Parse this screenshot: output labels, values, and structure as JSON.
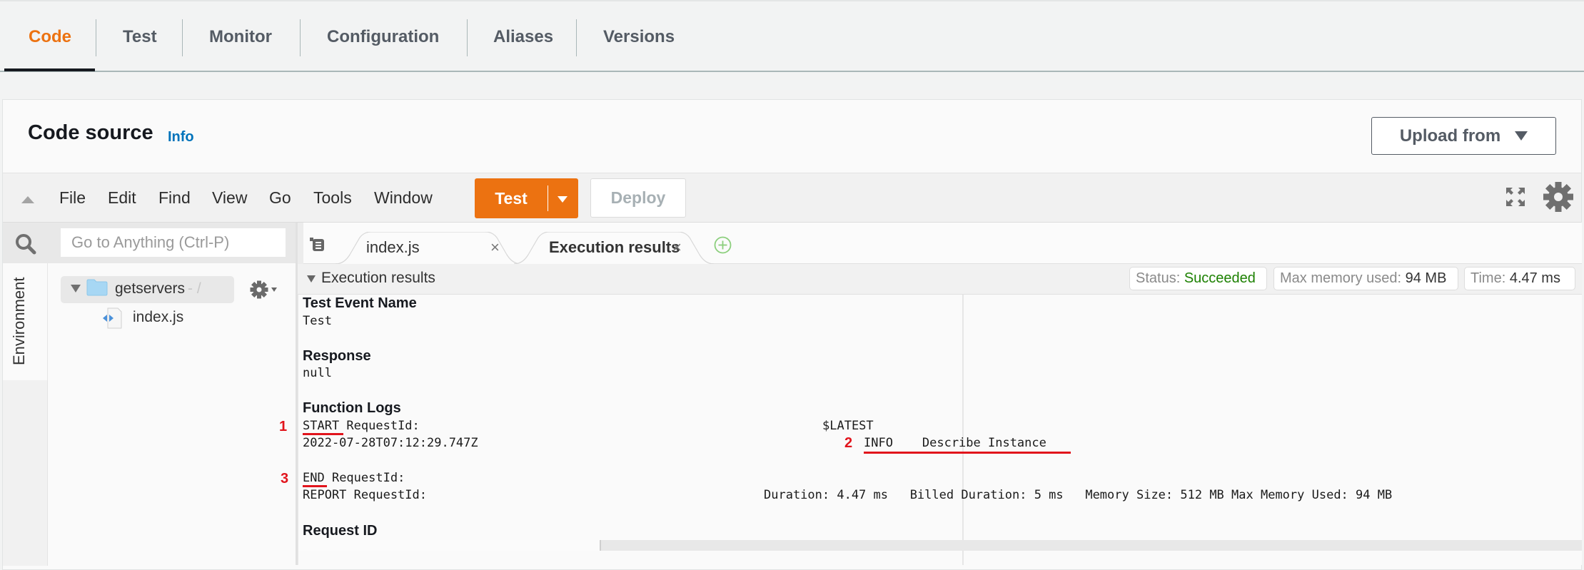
{
  "top_tabs": [
    {
      "label": "Code",
      "active": true
    },
    {
      "label": "Test",
      "active": false
    },
    {
      "label": "Monitor",
      "active": false
    },
    {
      "label": "Configuration",
      "active": false
    },
    {
      "label": "Aliases",
      "active": false
    },
    {
      "label": "Versions",
      "active": false
    }
  ],
  "code_source": {
    "title": "Code source",
    "info_link": "Info",
    "upload_button": "Upload from"
  },
  "toolbar": {
    "menus": [
      "File",
      "Edit",
      "Find",
      "View",
      "Go",
      "Tools",
      "Window"
    ],
    "test_button": "Test",
    "deploy_button": "Deploy"
  },
  "sidebar": {
    "search_placeholder": "Go to Anything (Ctrl-P)",
    "environment_label": "Environment",
    "tree": {
      "root": "getservers",
      "root_suffix": "- /",
      "files": [
        "index.js"
      ]
    }
  },
  "editor_tabs": [
    {
      "label": "index.js",
      "active": false
    },
    {
      "label": "Execution results",
      "active": true
    }
  ],
  "execution_results": {
    "title": "Execution results",
    "status_label": "Status:",
    "status_value": "Succeeded",
    "memory_label": "Max memory used:",
    "memory_value": "94 MB",
    "time_label": "Time:",
    "time_value": "4.47 ms",
    "sections": {
      "test_event_name_heading": "Test Event Name",
      "test_event_name_value": "Test",
      "response_heading": "Response",
      "response_value": "null",
      "function_logs_heading": "Function Logs",
      "request_id_heading": "Request ID"
    },
    "logs": {
      "start_keyword": "START",
      "start_rest": " RequestId:",
      "start_version": "$LATEST",
      "timestamp": "2022-07-28T07:12:29.747Z",
      "info_line": "INFO    Describe Instance",
      "end_keyword": "END",
      "end_rest": " RequestId:",
      "report_prefix": "REPORT RequestId:",
      "report_tail": "Duration: 4.47 ms   Billed Duration: 5 ms   Memory Size: 512 MB Max Memory Used: 94 MB"
    },
    "annotations": [
      "1",
      "2",
      "3"
    ]
  },
  "colors": {
    "accent_orange": "#ec7211",
    "link_blue": "#0073bb",
    "success_green": "#1d8102",
    "annotation_red": "#e1141c"
  }
}
